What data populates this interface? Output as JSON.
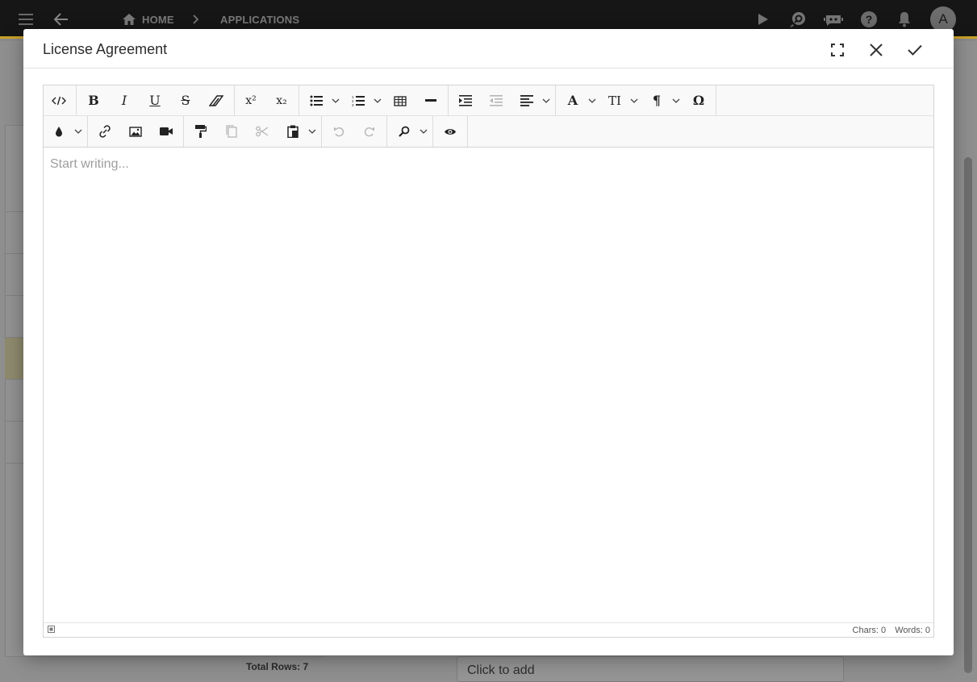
{
  "topbar": {
    "home_label": "HOME",
    "breadcrumb_current": "APPLICATIONS",
    "avatar_letter": "A"
  },
  "background": {
    "total_rows_label": "Total Rows: 7",
    "click_to_add": "Click to add"
  },
  "modal": {
    "title": "License Agreement"
  },
  "editor": {
    "placeholder": "Start writing...",
    "chars_label": "Chars: 0",
    "words_label": "Words: 0"
  },
  "toolbar": {
    "bold_glyph": "B",
    "italic_glyph": "I",
    "underline_glyph": "U",
    "strike_glyph": "S",
    "superscript_glyph": "x²",
    "subscript_glyph": "x₂",
    "font_glyph": "A",
    "size_glyph": "TI",
    "paragraph_glyph": "¶",
    "special_chars_glyph": "Ω"
  },
  "colors": {
    "topbar_bg": "#161616",
    "topbar_accent": "#c9a227",
    "modal_bg": "#ffffff",
    "toolbar_bg": "#f9f9f9"
  }
}
